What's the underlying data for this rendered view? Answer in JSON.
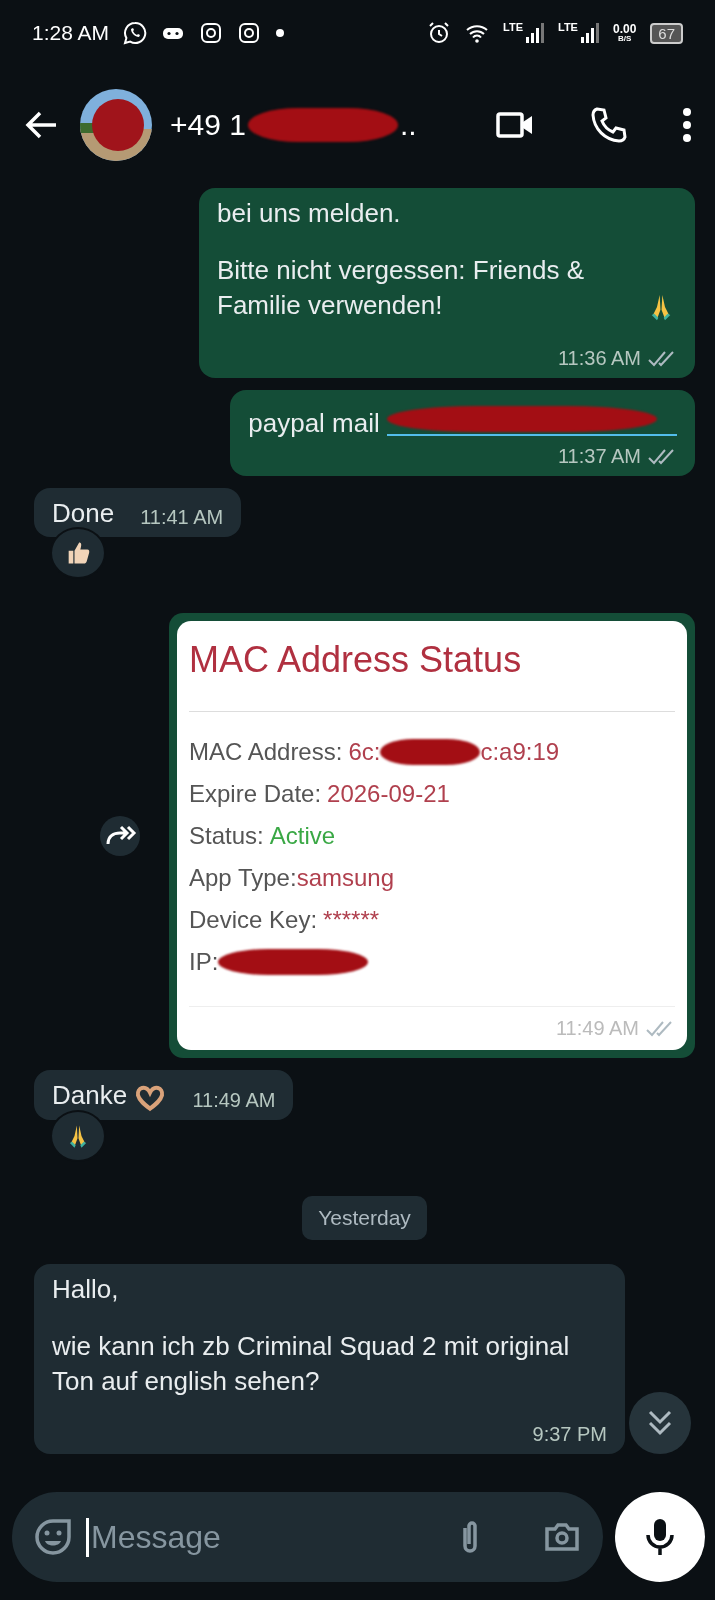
{
  "status_bar": {
    "time": "1:28 AM",
    "lte": [
      "LTE",
      "LTE"
    ],
    "speed": "0.00",
    "speed_unit": "B/S",
    "battery": "67"
  },
  "header": {
    "title": "+49 1",
    "redacted": true,
    "title_end": ".."
  },
  "messages": [
    {
      "kind": "text",
      "outgoing": true,
      "paragraphs": [
        "bei uns melden.",
        "Bitte nicht vergessen: Friends & Familie verwenden!"
      ],
      "trailing_icon": {
        "kind": "pray"
      },
      "time": "11:36 AM",
      "delivered": true
    },
    {
      "kind": "link",
      "outgoing": true,
      "text": "paypal mail",
      "link_redacted": true,
      "time": "11:37 AM",
      "delivered": true
    },
    {
      "kind": "text",
      "outgoing": false,
      "paragraphs": [
        "Done"
      ],
      "time": "11:41 AM",
      "reaction": {
        "kind": "thumbs"
      }
    },
    {
      "kind": "card",
      "outgoing": true,
      "forward": true,
      "title": "MAC Address Status",
      "rows": [
        {
          "label": "MAC Address:",
          "value": "6c:",
          "redacted": true,
          "value_end": "c:a9:19",
          "color": "#b0404e"
        },
        {
          "label": "Expire Date:",
          "value": "2026-09-21",
          "redacted": false,
          "color": "#b0404e"
        },
        {
          "label": "Status:",
          "value": "Active",
          "redacted": false,
          "color": "#3aa845"
        },
        {
          "label": "App Type:",
          "value": "samsung",
          "redacted": false,
          "color": "#b0404e"
        },
        {
          "label": "Device Key:",
          "value": "******",
          "redacted": false,
          "color": "#b0404e"
        },
        {
          "label": "IP:",
          "redacted": true
        }
      ],
      "time": "11:49 AM",
      "delivered": true
    },
    {
      "kind": "text",
      "outgoing": false,
      "paragraphs": [
        "Danke"
      ],
      "trailing_icon": {
        "kind": "heart_hands"
      },
      "time": "11:49 AM",
      "reaction": {
        "kind": "pray"
      }
    },
    {
      "kind": "date",
      "text": "Yesterday"
    },
    {
      "kind": "text",
      "outgoing": false,
      "paragraphs": [
        "Hallo,",
        "wie kann ich zb Criminal Squad 2 mit original Ton auf english sehen?"
      ],
      "time": "9:37 PM"
    }
  ],
  "composer": {
    "placeholder": "Message"
  }
}
